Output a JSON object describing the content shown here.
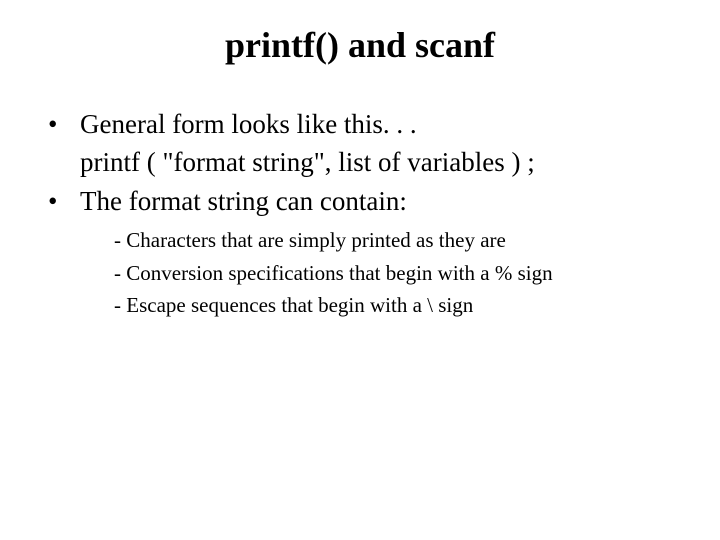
{
  "title": "printf() and scanf",
  "bullets": {
    "b1": "General form looks like this. . .",
    "b1_line2": "printf ( \"format string\", list of variables ) ;",
    "b2": "The format string can contain:"
  },
  "sub": {
    "s1": "- Characters that are simply printed as they are",
    "s2": "- Conversion specifications that begin with a % sign",
    "s3": "- Escape sequences that begin with a \\ sign"
  }
}
